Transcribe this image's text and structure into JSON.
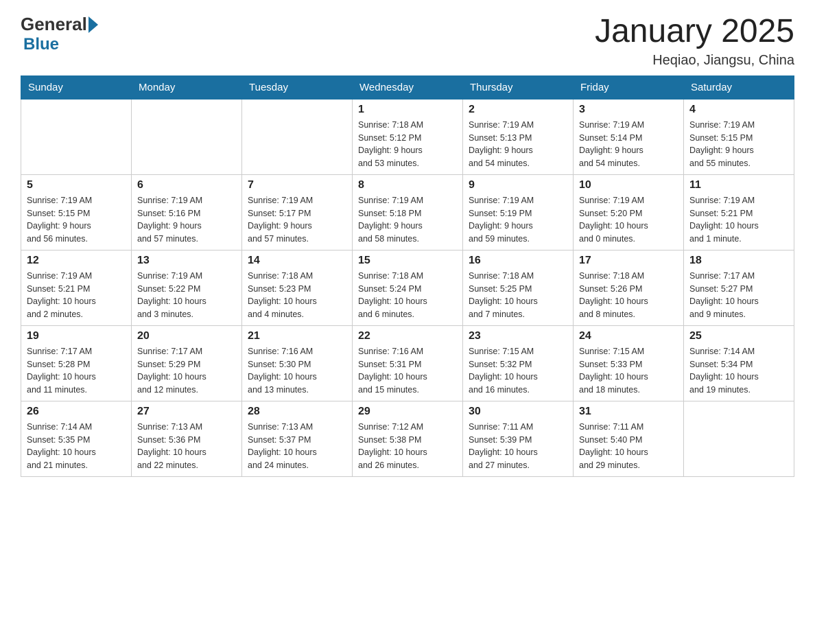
{
  "header": {
    "logo_general": "General",
    "logo_blue": "Blue",
    "month_title": "January 2025",
    "location": "Heqiao, Jiangsu, China"
  },
  "days_of_week": [
    "Sunday",
    "Monday",
    "Tuesday",
    "Wednesday",
    "Thursday",
    "Friday",
    "Saturday"
  ],
  "weeks": [
    [
      {
        "day": "",
        "info": ""
      },
      {
        "day": "",
        "info": ""
      },
      {
        "day": "",
        "info": ""
      },
      {
        "day": "1",
        "info": "Sunrise: 7:18 AM\nSunset: 5:12 PM\nDaylight: 9 hours\nand 53 minutes."
      },
      {
        "day": "2",
        "info": "Sunrise: 7:19 AM\nSunset: 5:13 PM\nDaylight: 9 hours\nand 54 minutes."
      },
      {
        "day": "3",
        "info": "Sunrise: 7:19 AM\nSunset: 5:14 PM\nDaylight: 9 hours\nand 54 minutes."
      },
      {
        "day": "4",
        "info": "Sunrise: 7:19 AM\nSunset: 5:15 PM\nDaylight: 9 hours\nand 55 minutes."
      }
    ],
    [
      {
        "day": "5",
        "info": "Sunrise: 7:19 AM\nSunset: 5:15 PM\nDaylight: 9 hours\nand 56 minutes."
      },
      {
        "day": "6",
        "info": "Sunrise: 7:19 AM\nSunset: 5:16 PM\nDaylight: 9 hours\nand 57 minutes."
      },
      {
        "day": "7",
        "info": "Sunrise: 7:19 AM\nSunset: 5:17 PM\nDaylight: 9 hours\nand 57 minutes."
      },
      {
        "day": "8",
        "info": "Sunrise: 7:19 AM\nSunset: 5:18 PM\nDaylight: 9 hours\nand 58 minutes."
      },
      {
        "day": "9",
        "info": "Sunrise: 7:19 AM\nSunset: 5:19 PM\nDaylight: 9 hours\nand 59 minutes."
      },
      {
        "day": "10",
        "info": "Sunrise: 7:19 AM\nSunset: 5:20 PM\nDaylight: 10 hours\nand 0 minutes."
      },
      {
        "day": "11",
        "info": "Sunrise: 7:19 AM\nSunset: 5:21 PM\nDaylight: 10 hours\nand 1 minute."
      }
    ],
    [
      {
        "day": "12",
        "info": "Sunrise: 7:19 AM\nSunset: 5:21 PM\nDaylight: 10 hours\nand 2 minutes."
      },
      {
        "day": "13",
        "info": "Sunrise: 7:19 AM\nSunset: 5:22 PM\nDaylight: 10 hours\nand 3 minutes."
      },
      {
        "day": "14",
        "info": "Sunrise: 7:18 AM\nSunset: 5:23 PM\nDaylight: 10 hours\nand 4 minutes."
      },
      {
        "day": "15",
        "info": "Sunrise: 7:18 AM\nSunset: 5:24 PM\nDaylight: 10 hours\nand 6 minutes."
      },
      {
        "day": "16",
        "info": "Sunrise: 7:18 AM\nSunset: 5:25 PM\nDaylight: 10 hours\nand 7 minutes."
      },
      {
        "day": "17",
        "info": "Sunrise: 7:18 AM\nSunset: 5:26 PM\nDaylight: 10 hours\nand 8 minutes."
      },
      {
        "day": "18",
        "info": "Sunrise: 7:17 AM\nSunset: 5:27 PM\nDaylight: 10 hours\nand 9 minutes."
      }
    ],
    [
      {
        "day": "19",
        "info": "Sunrise: 7:17 AM\nSunset: 5:28 PM\nDaylight: 10 hours\nand 11 minutes."
      },
      {
        "day": "20",
        "info": "Sunrise: 7:17 AM\nSunset: 5:29 PM\nDaylight: 10 hours\nand 12 minutes."
      },
      {
        "day": "21",
        "info": "Sunrise: 7:16 AM\nSunset: 5:30 PM\nDaylight: 10 hours\nand 13 minutes."
      },
      {
        "day": "22",
        "info": "Sunrise: 7:16 AM\nSunset: 5:31 PM\nDaylight: 10 hours\nand 15 minutes."
      },
      {
        "day": "23",
        "info": "Sunrise: 7:15 AM\nSunset: 5:32 PM\nDaylight: 10 hours\nand 16 minutes."
      },
      {
        "day": "24",
        "info": "Sunrise: 7:15 AM\nSunset: 5:33 PM\nDaylight: 10 hours\nand 18 minutes."
      },
      {
        "day": "25",
        "info": "Sunrise: 7:14 AM\nSunset: 5:34 PM\nDaylight: 10 hours\nand 19 minutes."
      }
    ],
    [
      {
        "day": "26",
        "info": "Sunrise: 7:14 AM\nSunset: 5:35 PM\nDaylight: 10 hours\nand 21 minutes."
      },
      {
        "day": "27",
        "info": "Sunrise: 7:13 AM\nSunset: 5:36 PM\nDaylight: 10 hours\nand 22 minutes."
      },
      {
        "day": "28",
        "info": "Sunrise: 7:13 AM\nSunset: 5:37 PM\nDaylight: 10 hours\nand 24 minutes."
      },
      {
        "day": "29",
        "info": "Sunrise: 7:12 AM\nSunset: 5:38 PM\nDaylight: 10 hours\nand 26 minutes."
      },
      {
        "day": "30",
        "info": "Sunrise: 7:11 AM\nSunset: 5:39 PM\nDaylight: 10 hours\nand 27 minutes."
      },
      {
        "day": "31",
        "info": "Sunrise: 7:11 AM\nSunset: 5:40 PM\nDaylight: 10 hours\nand 29 minutes."
      },
      {
        "day": "",
        "info": ""
      }
    ]
  ]
}
